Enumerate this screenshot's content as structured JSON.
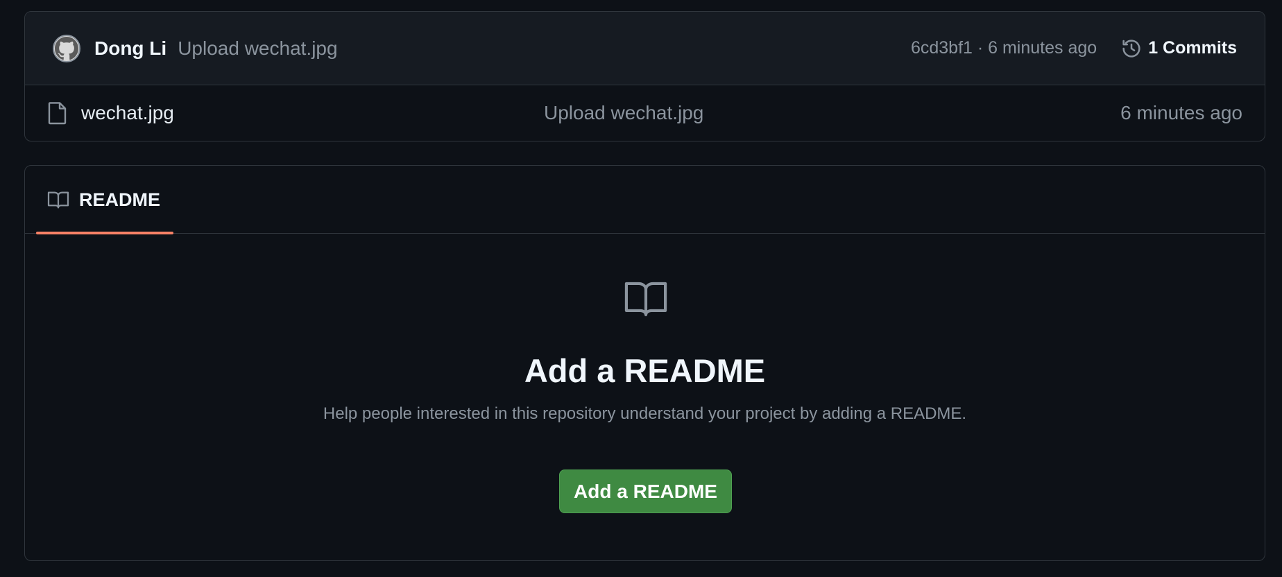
{
  "latest_commit": {
    "author": "Dong Li",
    "message": "Upload wechat.jpg",
    "sha_time": "6cd3bf1 · 6 minutes ago",
    "commits_label": "1 Commits",
    "avatar_icon": "github-octocat-avatar",
    "history_icon": "history-icon"
  },
  "files": [
    {
      "name": "wechat.jpg",
      "message": "Upload wechat.jpg",
      "time": "6 minutes ago",
      "icon": "file-icon"
    }
  ],
  "readme": {
    "tab_label": "README",
    "tab_icon": "book-icon",
    "empty_icon": "book-icon",
    "title": "Add a README",
    "description": "Help people interested in this repository understand your project by adding a README.",
    "button_label": "Add a README"
  },
  "colors": {
    "background": "#0d1117",
    "header_background": "#161b22",
    "border": "#30363d",
    "muted_text": "#8b949e",
    "tab_underline": "#f78166",
    "button_green": "#3f8a42"
  }
}
